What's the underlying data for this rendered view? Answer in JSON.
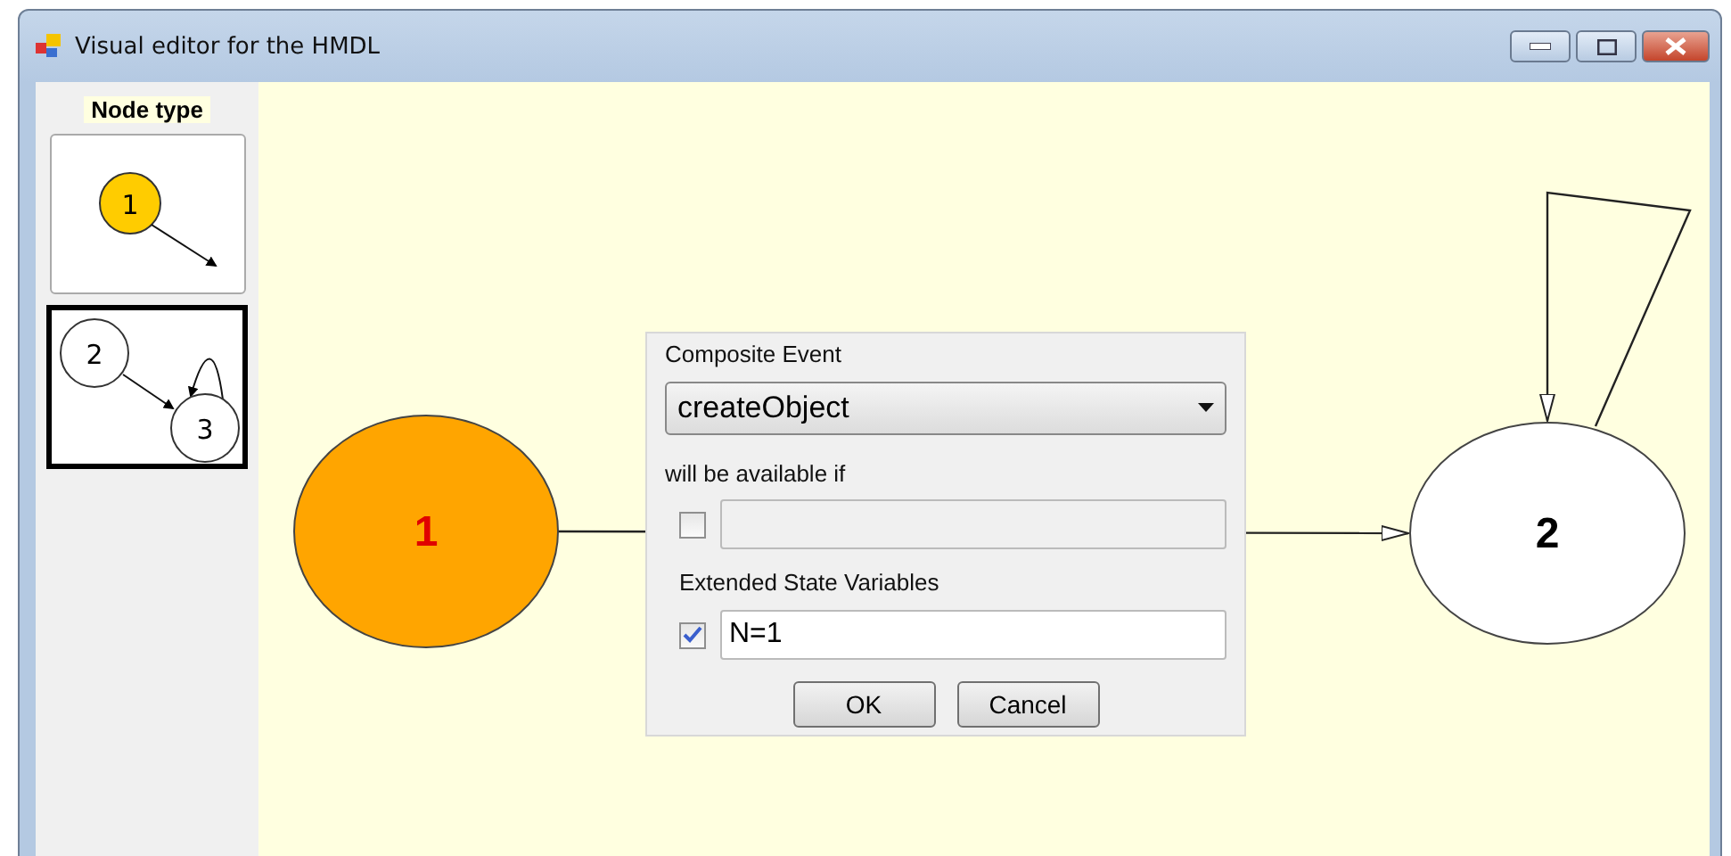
{
  "window": {
    "title": "Visual editor for the HMDL"
  },
  "sidebar": {
    "title": "Node type",
    "node_types": [
      {
        "kind": "single",
        "labels": [
          "1"
        ],
        "selected": false
      },
      {
        "kind": "loop",
        "labels": [
          "2",
          "3"
        ],
        "selected": true
      }
    ]
  },
  "canvas": {
    "nodes": [
      {
        "label": "1",
        "kind": "start",
        "color": "#ffa500"
      },
      {
        "label": "2",
        "kind": "normal",
        "color": "#ffffff"
      }
    ]
  },
  "dialog": {
    "event_label": "Composite Event",
    "event_value": "createObject",
    "condition_label": "will be available if",
    "condition": {
      "checked": false
    },
    "variables_label": "Extended State Variables",
    "variables": {
      "checked": true,
      "value": "N=1"
    },
    "buttons": [
      "OK",
      "Cancel"
    ]
  }
}
